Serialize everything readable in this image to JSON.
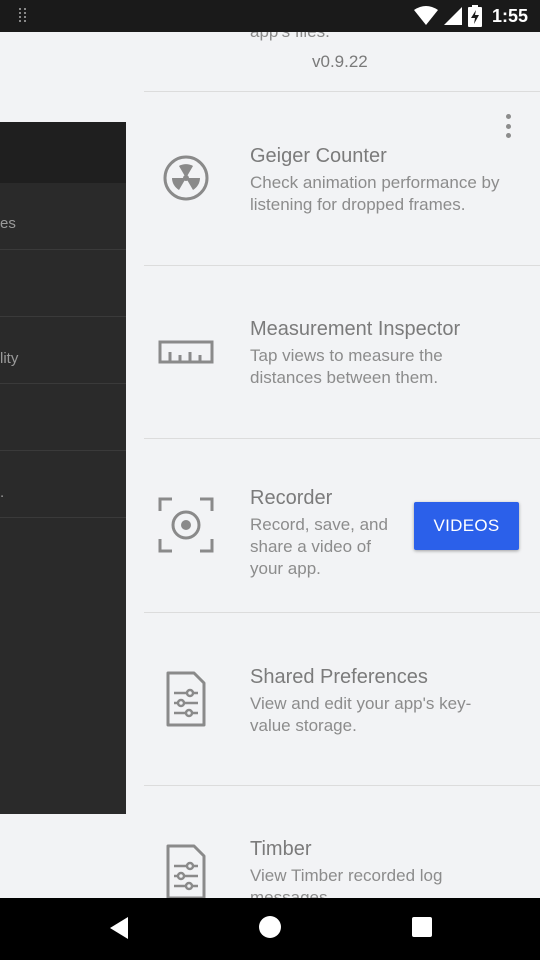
{
  "status_bar": {
    "time": "1:55",
    "icons": [
      "debug-dots-icon",
      "wifi-icon",
      "signal-icon",
      "battery-charging-icon"
    ]
  },
  "header": {
    "truncated_description": "app's files.",
    "version": "v0.9.22"
  },
  "tools": [
    {
      "title": "Geiger Counter",
      "description_lines": [
        "Check animation performance by",
        "listening for dropped frames."
      ],
      "icon": "radiation-icon"
    },
    {
      "title": "Measurement Inspector",
      "description_lines": [
        "Tap views to measure the",
        "distances between them."
      ],
      "icon": "ruler-icon"
    },
    {
      "title": "Recorder",
      "description_lines": [
        "Record, save, and",
        "share a video of",
        "your app."
      ],
      "icon": "record-icon",
      "action_label": "VIDEOS"
    },
    {
      "title": "Shared Preferences",
      "description_lines": [
        "View and edit your app's key-",
        "value storage."
      ],
      "icon": "settings-file-icon"
    },
    {
      "title": "Timber",
      "description_lines": [
        "View Timber recorded log",
        "messages."
      ],
      "icon": "log-file-icon"
    }
  ],
  "drawer": {
    "rows": [
      {
        "text": "es"
      },
      {
        "text": ""
      },
      {
        "text": "lity"
      },
      {
        "text": ""
      },
      {
        "text": "."
      },
      {
        "text": ""
      }
    ]
  },
  "nav": {
    "icons": [
      "back-icon",
      "home-icon",
      "recents-icon"
    ]
  }
}
